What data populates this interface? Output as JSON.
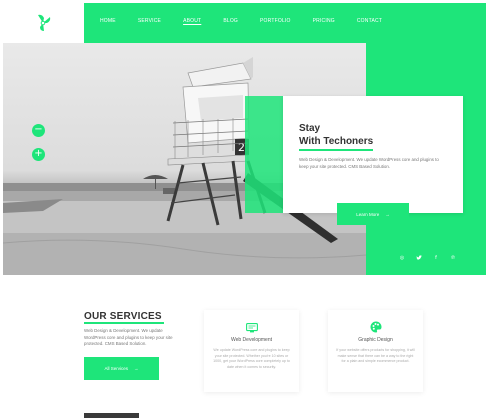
{
  "brand": {
    "logo_icon": "propeller-logo-icon",
    "accent": "#1ee57a"
  },
  "nav": {
    "items": [
      {
        "label": "HOME",
        "active": false
      },
      {
        "label": "SERVICE",
        "active": false
      },
      {
        "label": "ABOUT",
        "active": true
      },
      {
        "label": "BLOG",
        "active": false
      },
      {
        "label": "PORTFOLIO",
        "active": false
      },
      {
        "label": "PRICING",
        "active": false
      },
      {
        "label": "CONTACT",
        "active": false
      }
    ]
  },
  "slider": {
    "prev_symbol": "−",
    "next_symbol": "+"
  },
  "hero_card": {
    "title_line1": "Stay",
    "title_line2": "With Techoners",
    "description": "Web Design & Development. We update WordPress core and plugins to keep your site protected. CMS Based Solution.",
    "button_label": "Learn More",
    "button_arrow": "→"
  },
  "socials": [
    {
      "icon": "instagram-icon",
      "glyph": "◎"
    },
    {
      "icon": "twitter-icon",
      "glyph": "🐦"
    },
    {
      "icon": "facebook-icon",
      "glyph": "f"
    },
    {
      "icon": "pinterest-icon",
      "glyph": "℗"
    }
  ],
  "services": {
    "title": "OUR SERVICES",
    "description": "Web Design & Development. We update WordPress core and plugins to keep your site protected. CMS Based Solution.",
    "button_label": "All Services",
    "button_arrow": "→",
    "cards": [
      {
        "icon": "monitor-icon",
        "name": "Web Development",
        "description": "We update WordPress core and plugins to keep your site protected. Whether you're 10 sites or 1000, get your WordPress core completely up to date when it comes to security."
      },
      {
        "icon": "palette-icon",
        "name": "Graphic Design",
        "description": "If your website offers products for shopping, it will make sense that there can be a way to the right for a plain and simple ecommerce product."
      }
    ]
  }
}
